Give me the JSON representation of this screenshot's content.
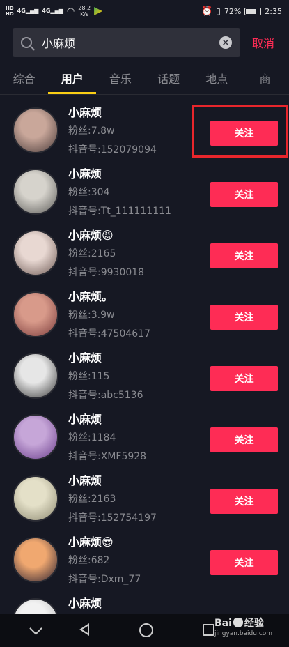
{
  "status_bar": {
    "hd1": "HD",
    "hd2": "HD",
    "net1": "4G",
    "net2": "4G",
    "speed_value": "28.2",
    "speed_unit": "K/s",
    "battery_pct": "72%",
    "battery_level": 0.72,
    "time": "2:35"
  },
  "search": {
    "query": "小麻烦",
    "cancel_label": "取消"
  },
  "tabs": [
    {
      "label": "综合",
      "active": false
    },
    {
      "label": "用户",
      "active": true
    },
    {
      "label": "音乐",
      "active": false
    },
    {
      "label": "话题",
      "active": false
    },
    {
      "label": "地点",
      "active": false
    },
    {
      "label": "商",
      "active": false
    }
  ],
  "users": [
    {
      "name": "小麻烦",
      "fans": "粉丝:7.8w",
      "douyin_id": "抖音号:152079094",
      "follow_label": "关注",
      "avatar_colors": [
        "#c9a79a",
        "#4a3b3a"
      ]
    },
    {
      "name": "小麻烦",
      "fans": "粉丝:304",
      "douyin_id": "抖音号:Tt_111111111",
      "follow_label": "关注",
      "avatar_colors": [
        "#d6d3cc",
        "#5b5a57"
      ]
    },
    {
      "name": "小麻烦😡",
      "fans": "粉丝:2165",
      "douyin_id": "抖音号:9930018",
      "follow_label": "关注",
      "avatar_colors": [
        "#e8d8d2",
        "#6e5a55"
      ]
    },
    {
      "name": "小麻烦。",
      "fans": "粉丝:3.9w",
      "douyin_id": "抖音号:47504617",
      "follow_label": "关注",
      "avatar_colors": [
        "#d89a8a",
        "#7a3b3b"
      ]
    },
    {
      "name": "小麻烦",
      "fans": "粉丝:115",
      "douyin_id": "抖音号:abc5136",
      "follow_label": "关注",
      "avatar_colors": [
        "#e6e6e6",
        "#3c3c3c"
      ]
    },
    {
      "name": "小麻烦",
      "fans": "粉丝:1184",
      "douyin_id": "抖音号:XMF5928",
      "follow_label": "关注",
      "avatar_colors": [
        "#c6a6d8",
        "#6b3e8c"
      ]
    },
    {
      "name": "小麻烦",
      "fans": "粉丝:2163",
      "douyin_id": "抖音号:152754197",
      "follow_label": "关注",
      "avatar_colors": [
        "#e4e0c8",
        "#8c8870"
      ]
    },
    {
      "name": "小麻烦😎",
      "fans": "粉丝:682",
      "douyin_id": "抖音号:Dxm_77",
      "follow_label": "关注",
      "avatar_colors": [
        "#f0a870",
        "#2a2030"
      ]
    },
    {
      "name": "小麻烦",
      "fans": "",
      "douyin_id": "",
      "follow_label": "",
      "avatar_colors": [
        "#f2f2f2",
        "#b0b0b0"
      ]
    }
  ],
  "watermark": {
    "main_left": "Bai",
    "main_right": "经验",
    "sub": "jingyan.baidu.com"
  }
}
